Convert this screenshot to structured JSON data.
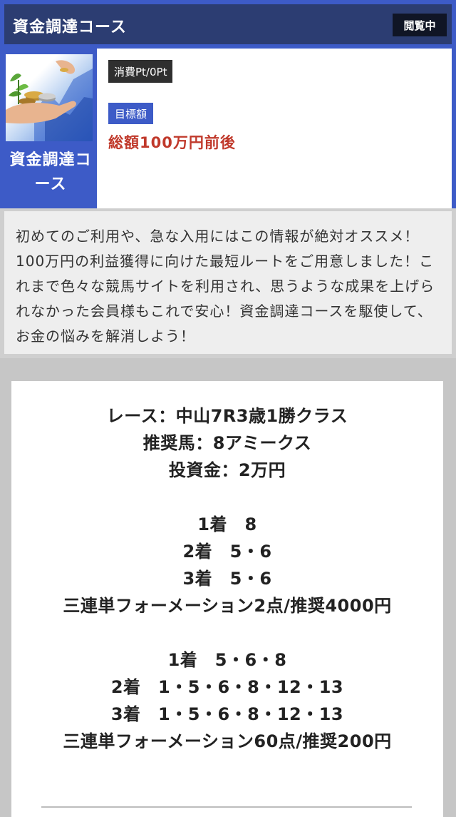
{
  "header": {
    "title": "資金調達コース",
    "status_badge": "閲覧中"
  },
  "course": {
    "thumbnail_icon": "coins-in-hand-image",
    "name": "資金調達コース",
    "points_badge": "消費Pt/0Pt",
    "target_label": "目標額",
    "target_value": "総額100万円前後"
  },
  "description": "初めてのご利用や、急な入用にはこの情報が絶対オススメ！100万円の利益獲得に向けた最短ルートをご用意しました！これまで色々な競馬サイトを利用され、思うような成果を上げられなかった会員様もこれで安心！資金調達コースを駆使して、お金の悩みを解消しよう！",
  "picks": {
    "race": "レース：中山7R3歳1勝クラス",
    "horse": "推奨馬：8アミークス",
    "stake": "投資金：2万円",
    "formation1": {
      "first": "1着　8",
      "second": "2着　5・6",
      "third": "3着　5・6",
      "summary": "三連単フォーメーション2点/推奨4000円"
    },
    "formation2": {
      "first": "1着　5・6・8",
      "second": "2着　1・5・6・8・12・13",
      "third": "3着　1・5・6・8・12・13",
      "summary": "三連単フォーメーション60点/推奨200円"
    }
  }
}
